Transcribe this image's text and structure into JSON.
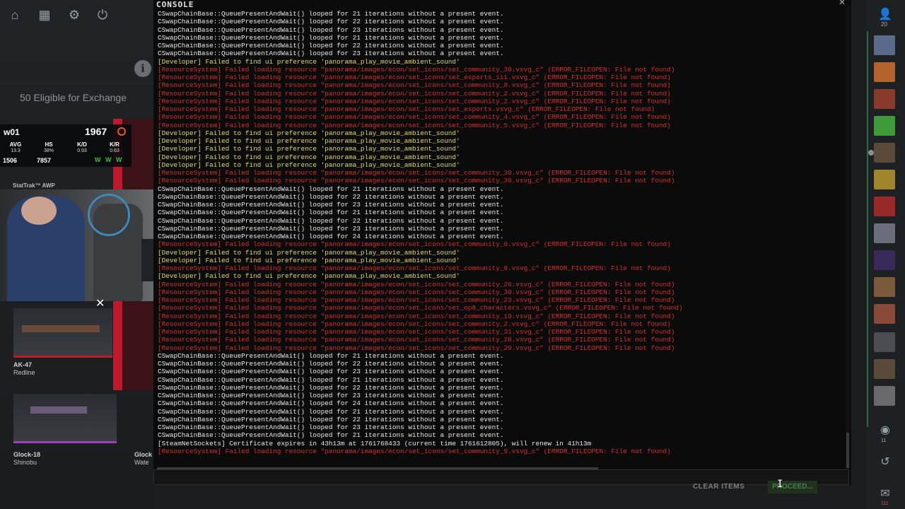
{
  "console": {
    "title": "CONSOLE",
    "lines": [
      {
        "t": "w",
        "text": "CSwapChainBase::QueuePresentAndWait() looped for 21 iterations without a present event."
      },
      {
        "t": "w",
        "text": "CSwapChainBase::QueuePresentAndWait() looped for 22 iterations without a present event."
      },
      {
        "t": "w",
        "text": "CSwapChainBase::QueuePresentAndWait() looped for 23 iterations without a present event."
      },
      {
        "t": "w",
        "text": "CSwapChainBase::QueuePresentAndWait() looped for 21 iterations without a present event."
      },
      {
        "t": "w",
        "text": "CSwapChainBase::QueuePresentAndWait() looped for 22 iterations without a present event."
      },
      {
        "t": "w",
        "text": "CSwapChainBase::QueuePresentAndWait() looped for 23 iterations without a present event."
      },
      {
        "t": "y",
        "text": "[Developer] Failed to find ui preference 'panorama_play_movie_ambient_sound'"
      },
      {
        "t": "r",
        "text": "[ResourceSystem] Failed loading resource \"panorama/images/econ/set_icons/set_community_30.vsvg_c\" (ERROR_FILEOPEN: File not found)"
      },
      {
        "t": "r",
        "text": "[ResourceSystem] Failed loading resource \"panorama/images/econ/set_icons/set_esports_iii.vsvg_c\" (ERROR_FILEOPEN: File not found)"
      },
      {
        "t": "r",
        "text": "[ResourceSystem] Failed loading resource \"panorama/images/econ/set_icons/set_community_8.vsvg_c\" (ERROR_FILEOPEN: File not found)"
      },
      {
        "t": "r",
        "text": "[ResourceSystem] Failed loading resource \"panorama/images/econ/set_icons/set_community_2.vsvg_c\" (ERROR_FILEOPEN: File not found)"
      },
      {
        "t": "r",
        "text": "[ResourceSystem] Failed loading resource \"panorama/images/econ/set_icons/set_community_2.vsvg_c\" (ERROR_FILEOPEN: File not found)"
      },
      {
        "t": "r",
        "text": "[ResourceSystem] Failed loading resource \"panorama/images/econ/set_icons/set_esports.vsvg_c\" (ERROR_FILEOPEN: File not found)"
      },
      {
        "t": "r",
        "text": "[ResourceSystem] Failed loading resource \"panorama/images/econ/set_icons/set_community_4.vsvg_c\" (ERROR_FILEOPEN: File not found)"
      },
      {
        "t": "r",
        "text": "[ResourceSystem] Failed loading resource \"panorama/images/econ/set_icons/set_community_5.vsvg_c\" (ERROR_FILEOPEN: File not found)"
      },
      {
        "t": "y",
        "text": "[Developer] Failed to find ui preference 'panorama_play_movie_ambient_sound'"
      },
      {
        "t": "y",
        "text": "[Developer] Failed to find ui preference 'panorama_play_movie_ambient_sound'"
      },
      {
        "t": "y",
        "text": "[Developer] Failed to find ui preference 'panorama_play_movie_ambient_sound'"
      },
      {
        "t": "y",
        "text": "[Developer] Failed to find ui preference 'panorama_play_movie_ambient_sound'"
      },
      {
        "t": "y",
        "text": "[Developer] Failed to find ui preference 'panorama_play_movie_ambient_sound'"
      },
      {
        "t": "r",
        "text": "[ResourceSystem] Failed loading resource \"panorama/images/econ/set_icons/set_community_30.vsvg_c\" (ERROR_FILEOPEN: File not found)"
      },
      {
        "t": "r",
        "text": "[ResourceSystem] Failed loading resource \"panorama/images/econ/set_icons/set_community_30.vsvg_c\" (ERROR_FILEOPEN: File not found)"
      },
      {
        "t": "w",
        "text": "CSwapChainBase::QueuePresentAndWait() looped for 21 iterations without a present event."
      },
      {
        "t": "w",
        "text": "CSwapChainBase::QueuePresentAndWait() looped for 22 iterations without a present event."
      },
      {
        "t": "w",
        "text": "CSwapChainBase::QueuePresentAndWait() looped for 23 iterations without a present event."
      },
      {
        "t": "w",
        "text": "CSwapChainBase::QueuePresentAndWait() looped for 21 iterations without a present event."
      },
      {
        "t": "w",
        "text": "CSwapChainBase::QueuePresentAndWait() looped for 22 iterations without a present event."
      },
      {
        "t": "w",
        "text": "CSwapChainBase::QueuePresentAndWait() looped for 23 iterations without a present event."
      },
      {
        "t": "w",
        "text": "CSwapChainBase::QueuePresentAndWait() looped for 24 iterations without a present event."
      },
      {
        "t": "r",
        "text": "[ResourceSystem] Failed loading resource \"panorama/images/econ/set_icons/set_community_6.vsvg_c\" (ERROR_FILEOPEN: File not found)"
      },
      {
        "t": "y",
        "text": "[Developer] Failed to find ui preference 'panorama_play_movie_ambient_sound'"
      },
      {
        "t": "y",
        "text": "[Developer] Failed to find ui preference 'panorama_play_movie_ambient_sound'"
      },
      {
        "t": "r",
        "text": "[ResourceSystem] Failed loading resource \"panorama/images/econ/set_icons/set_community_8.vsvg_c\" (ERROR_FILEOPEN: File not found)"
      },
      {
        "t": "y",
        "text": "[Developer] Failed to find ui preference 'panorama_play_movie_ambient_sound'"
      },
      {
        "t": "r",
        "text": "[ResourceSystem] Failed loading resource \"panorama/images/econ/set_icons/set_community_26.vsvg_c\" (ERROR_FILEOPEN: File not found)"
      },
      {
        "t": "r",
        "text": "[ResourceSystem] Failed loading resource \"panorama/images/econ/set_icons/set_community_30.vsvg_c\" (ERROR_FILEOPEN: File not found)"
      },
      {
        "t": "r",
        "text": "[ResourceSystem] Failed loading resource \"panorama/images/econ/set_icons/set_community_23.vsvg_c\" (ERROR_FILEOPEN: File not found)"
      },
      {
        "t": "r",
        "text": "[ResourceSystem] Failed loading resource \"panorama/images/econ/set_icons/set_op8_characters.vsvg_c\" (ERROR_FILEOPEN: File not found)"
      },
      {
        "t": "r",
        "text": "[ResourceSystem] Failed loading resource \"panorama/images/econ/set_icons/set_community_19.vsvg_c\" (ERROR_FILEOPEN: File not found)"
      },
      {
        "t": "r",
        "text": "[ResourceSystem] Failed loading resource \"panorama/images/econ/set_icons/set_community_2.vsvg_c\" (ERROR_FILEOPEN: File not found)"
      },
      {
        "t": "r",
        "text": "[ResourceSystem] Failed loading resource \"panorama/images/econ/set_icons/set_community_31.vsvg_c\" (ERROR_FILEOPEN: File not found)"
      },
      {
        "t": "r",
        "text": "[ResourceSystem] Failed loading resource \"panorama/images/econ/set_icons/set_community_28.vsvg_c\" (ERROR_FILEOPEN: File not found)"
      },
      {
        "t": "r",
        "text": "[ResourceSystem] Failed loading resource \"panorama/images/econ/set_icons/set_community_29.vsvg_c\" (ERROR_FILEOPEN: File not found)"
      },
      {
        "t": "w",
        "text": "CSwapChainBase::QueuePresentAndWait() looped for 21 iterations without a present event."
      },
      {
        "t": "w",
        "text": "CSwapChainBase::QueuePresentAndWait() looped for 22 iterations without a present event."
      },
      {
        "t": "w",
        "text": "CSwapChainBase::QueuePresentAndWait() looped for 23 iterations without a present event."
      },
      {
        "t": "w",
        "text": "CSwapChainBase::QueuePresentAndWait() looped for 21 iterations without a present event."
      },
      {
        "t": "w",
        "text": "CSwapChainBase::QueuePresentAndWait() looped for 22 iterations without a present event."
      },
      {
        "t": "w",
        "text": "CSwapChainBase::QueuePresentAndWait() looped for 23 iterations without a present event."
      },
      {
        "t": "w",
        "text": "CSwapChainBase::QueuePresentAndWait() looped for 24 iterations without a present event."
      },
      {
        "t": "w",
        "text": "CSwapChainBase::QueuePresentAndWait() looped for 21 iterations without a present event."
      },
      {
        "t": "w",
        "text": "CSwapChainBase::QueuePresentAndWait() looped for 22 iterations without a present event."
      },
      {
        "t": "w",
        "text": "CSwapChainBase::QueuePresentAndWait() looped for 23 iterations without a present event."
      },
      {
        "t": "w",
        "text": "CSwapChainBase::QueuePresentAndWait() looped for 21 iterations without a present event."
      },
      {
        "t": "w",
        "text": "[SteamNetSockets] Certificate expires in 43h13m at 1761768433 (current time 1761612805), will renew in 41h13m"
      },
      {
        "t": "r",
        "text": "[ResourceSystem] Failed loading resource \"panorama/images/econ/set_icons/set_community_9.vsvg_c\" (ERROR_FILEOPEN: File not found)"
      }
    ],
    "input_value": "",
    "clear_label": "CLEAR ITEMS",
    "proceed_label": "PROCEED..."
  },
  "sidebar": {
    "eligible_text": "50 Eligible for Exchange"
  },
  "stats": {
    "name": "w01",
    "elo": "1967",
    "avg_label": "AVG",
    "avg_value": "13.3",
    "hs_label": "HS",
    "hs_value": "38%",
    "kd_label": "K/D",
    "kd_value": "0.93",
    "kr_label": "K/R",
    "kr_value": "0.63",
    "p1": "1506",
    "p2": "7857",
    "recent": "W W W"
  },
  "items": {
    "stattrak_label": "StatTrak™ AWP",
    "ak_name": "AK-47",
    "ak_skin": "Redline",
    "glock_name": "Glock-18",
    "glock_skin": "Shinobu",
    "glock2_name": "Glock",
    "glock2_skin": "Wate"
  },
  "friends": {
    "count": "20",
    "badge1": "11",
    "badge2": "111"
  },
  "colors": {
    "console_bg": "#0b0b0b",
    "text_white": "#e9e9e9",
    "text_yellow": "#e3d86a",
    "text_red": "#d3302e",
    "accent_red": "#c0192c"
  }
}
